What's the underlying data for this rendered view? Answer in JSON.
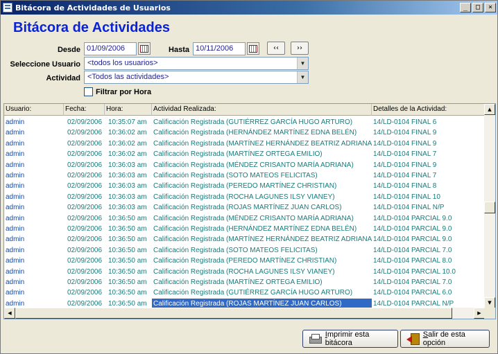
{
  "window": {
    "title": "Bitácora de Actividades de Usuarios",
    "min": "_",
    "max": "□",
    "close": "×"
  },
  "app_title": "Bitácora de Actividades",
  "filters": {
    "desde_label": "Desde",
    "desde_value": "01/09/2006",
    "hasta_label": "Hasta",
    "hasta_value": "10/11/2006",
    "prev_label": "‹‹",
    "next_label": "››",
    "usuario_label": "Seleccione Usuario",
    "usuario_value": "<todos los usuarios>",
    "actividad_label": "Actividad",
    "actividad_value": "<Todos las actividades>",
    "filtrar_label": "Filtrar por Hora"
  },
  "table": {
    "columns": [
      "Usuario:",
      "Fecha:",
      "Hora:",
      "Actividad Realizada:",
      "Detalles de la Actividad:"
    ],
    "rows": [
      [
        "admin",
        "02/09/2006",
        "10:35:07 am",
        "Calificación Registrada (GUTIÉRREZ GARCÍA HUGO ARTURO)",
        "14/LD-0104 FINAL 6"
      ],
      [
        "admin",
        "02/09/2006",
        "10:36:02 am",
        "Calificación Registrada (HERNÁNDEZ MARTÍNEZ EDNA BELÉN)",
        "14/LD-0104 FINAL 9"
      ],
      [
        "admin",
        "02/09/2006",
        "10:36:02 am",
        "Calificación Registrada (MARTÍNEZ HERNÁNDEZ BEATRIZ ADRIANA)",
        "14/LD-0104 FINAL 9"
      ],
      [
        "admin",
        "02/09/2006",
        "10:36:02 am",
        "Calificación Registrada (MARTÍNEZ ORTEGA EMILIO)",
        "14/LD-0104 FINAL 7"
      ],
      [
        "admin",
        "02/09/2006",
        "10:36:03 am",
        "Calificación Registrada (MÉNDEZ CRISANTO MARÍA ADRIANA)",
        "14/LD-0104 FINAL 9"
      ],
      [
        "admin",
        "02/09/2006",
        "10:36:03 am",
        "Calificación Registrada (SOTO MATEOS FELICITAS)",
        "14/LD-0104 FINAL 7"
      ],
      [
        "admin",
        "02/09/2006",
        "10:36:03 am",
        "Calificación Registrada (PEREDO MARTÍNEZ CHRISTIAN)",
        "14/LD-0104 FINAL 8"
      ],
      [
        "admin",
        "02/09/2006",
        "10:36:03 am",
        "Calificación Registrada (ROCHA LAGUNES ILSY VIANEY)",
        "14/LD-0104 FINAL 10"
      ],
      [
        "admin",
        "02/09/2006",
        "10:36:03 am",
        "Calificación Registrada (ROJAS MARTÍNEZ JUAN CARLOS)",
        "14/LD-0104 FINAL N/P"
      ],
      [
        "admin",
        "02/09/2006",
        "10:36:50 am",
        "Calificación Registrada (MÉNDEZ CRISANTO MARÍA ADRIANA)",
        "14/LD-0104 PARCIAL 9.0"
      ],
      [
        "admin",
        "02/09/2006",
        "10:36:50 am",
        "Calificación Registrada (HERNÁNDEZ MARTÍNEZ EDNA BELÉN)",
        "14/LD-0104 PARCIAL 9.0"
      ],
      [
        "admin",
        "02/09/2006",
        "10:36:50 am",
        "Calificación Registrada (MARTÍNEZ HERNÁNDEZ BEATRIZ ADRIANA)",
        "14/LD-0104 PARCIAL 9.0"
      ],
      [
        "admin",
        "02/09/2006",
        "10:36:50 am",
        "Calificación Registrada (SOTO MATEOS FELICITAS)",
        "14/LD-0104 PARCIAL 7.0"
      ],
      [
        "admin",
        "02/09/2006",
        "10:36:50 am",
        "Calificación Registrada (PEREDO MARTÍNEZ CHRISTIAN)",
        "14/LD-0104 PARCIAL 8.0"
      ],
      [
        "admin",
        "02/09/2006",
        "10:36:50 am",
        "Calificación Registrada (ROCHA LAGUNES ILSY VIANEY)",
        "14/LD-0104 PARCIAL 10.0"
      ],
      [
        "admin",
        "02/09/2006",
        "10:36:50 am",
        "Calificación Registrada (MARTÍNEZ ORTEGA EMILIO)",
        "14/LD-0104 PARCIAL 7.0"
      ],
      [
        "admin",
        "02/09/2006",
        "10:36:50 am",
        "Calificación Registrada (GUTIÉRREZ GARCÍA HUGO ARTURO)",
        "14/LD-0104 PARCIAL 6.0"
      ],
      [
        "admin",
        "02/09/2006",
        "10:36:50 am",
        "Calificación Registrada (ROJAS MARTÍNEZ JUAN CARLOS)",
        "14/LD-0104 PARCIAL N/P"
      ]
    ],
    "selected_row": 17,
    "selected_col": 3
  },
  "buttons": {
    "print_label": "mprimir esta bitácora",
    "print_accel": "I",
    "exit_label": "alir de esta opción",
    "exit_accel": "S"
  },
  "colors": {
    "title_blue": "#0a22d6",
    "row_text": "#1a7a7a",
    "selection": "#316ac5"
  },
  "icons": [
    "calendar-icon",
    "calendar-icon",
    "dropdown-arrow-icon",
    "printer-icon",
    "exit-door-icon"
  ]
}
